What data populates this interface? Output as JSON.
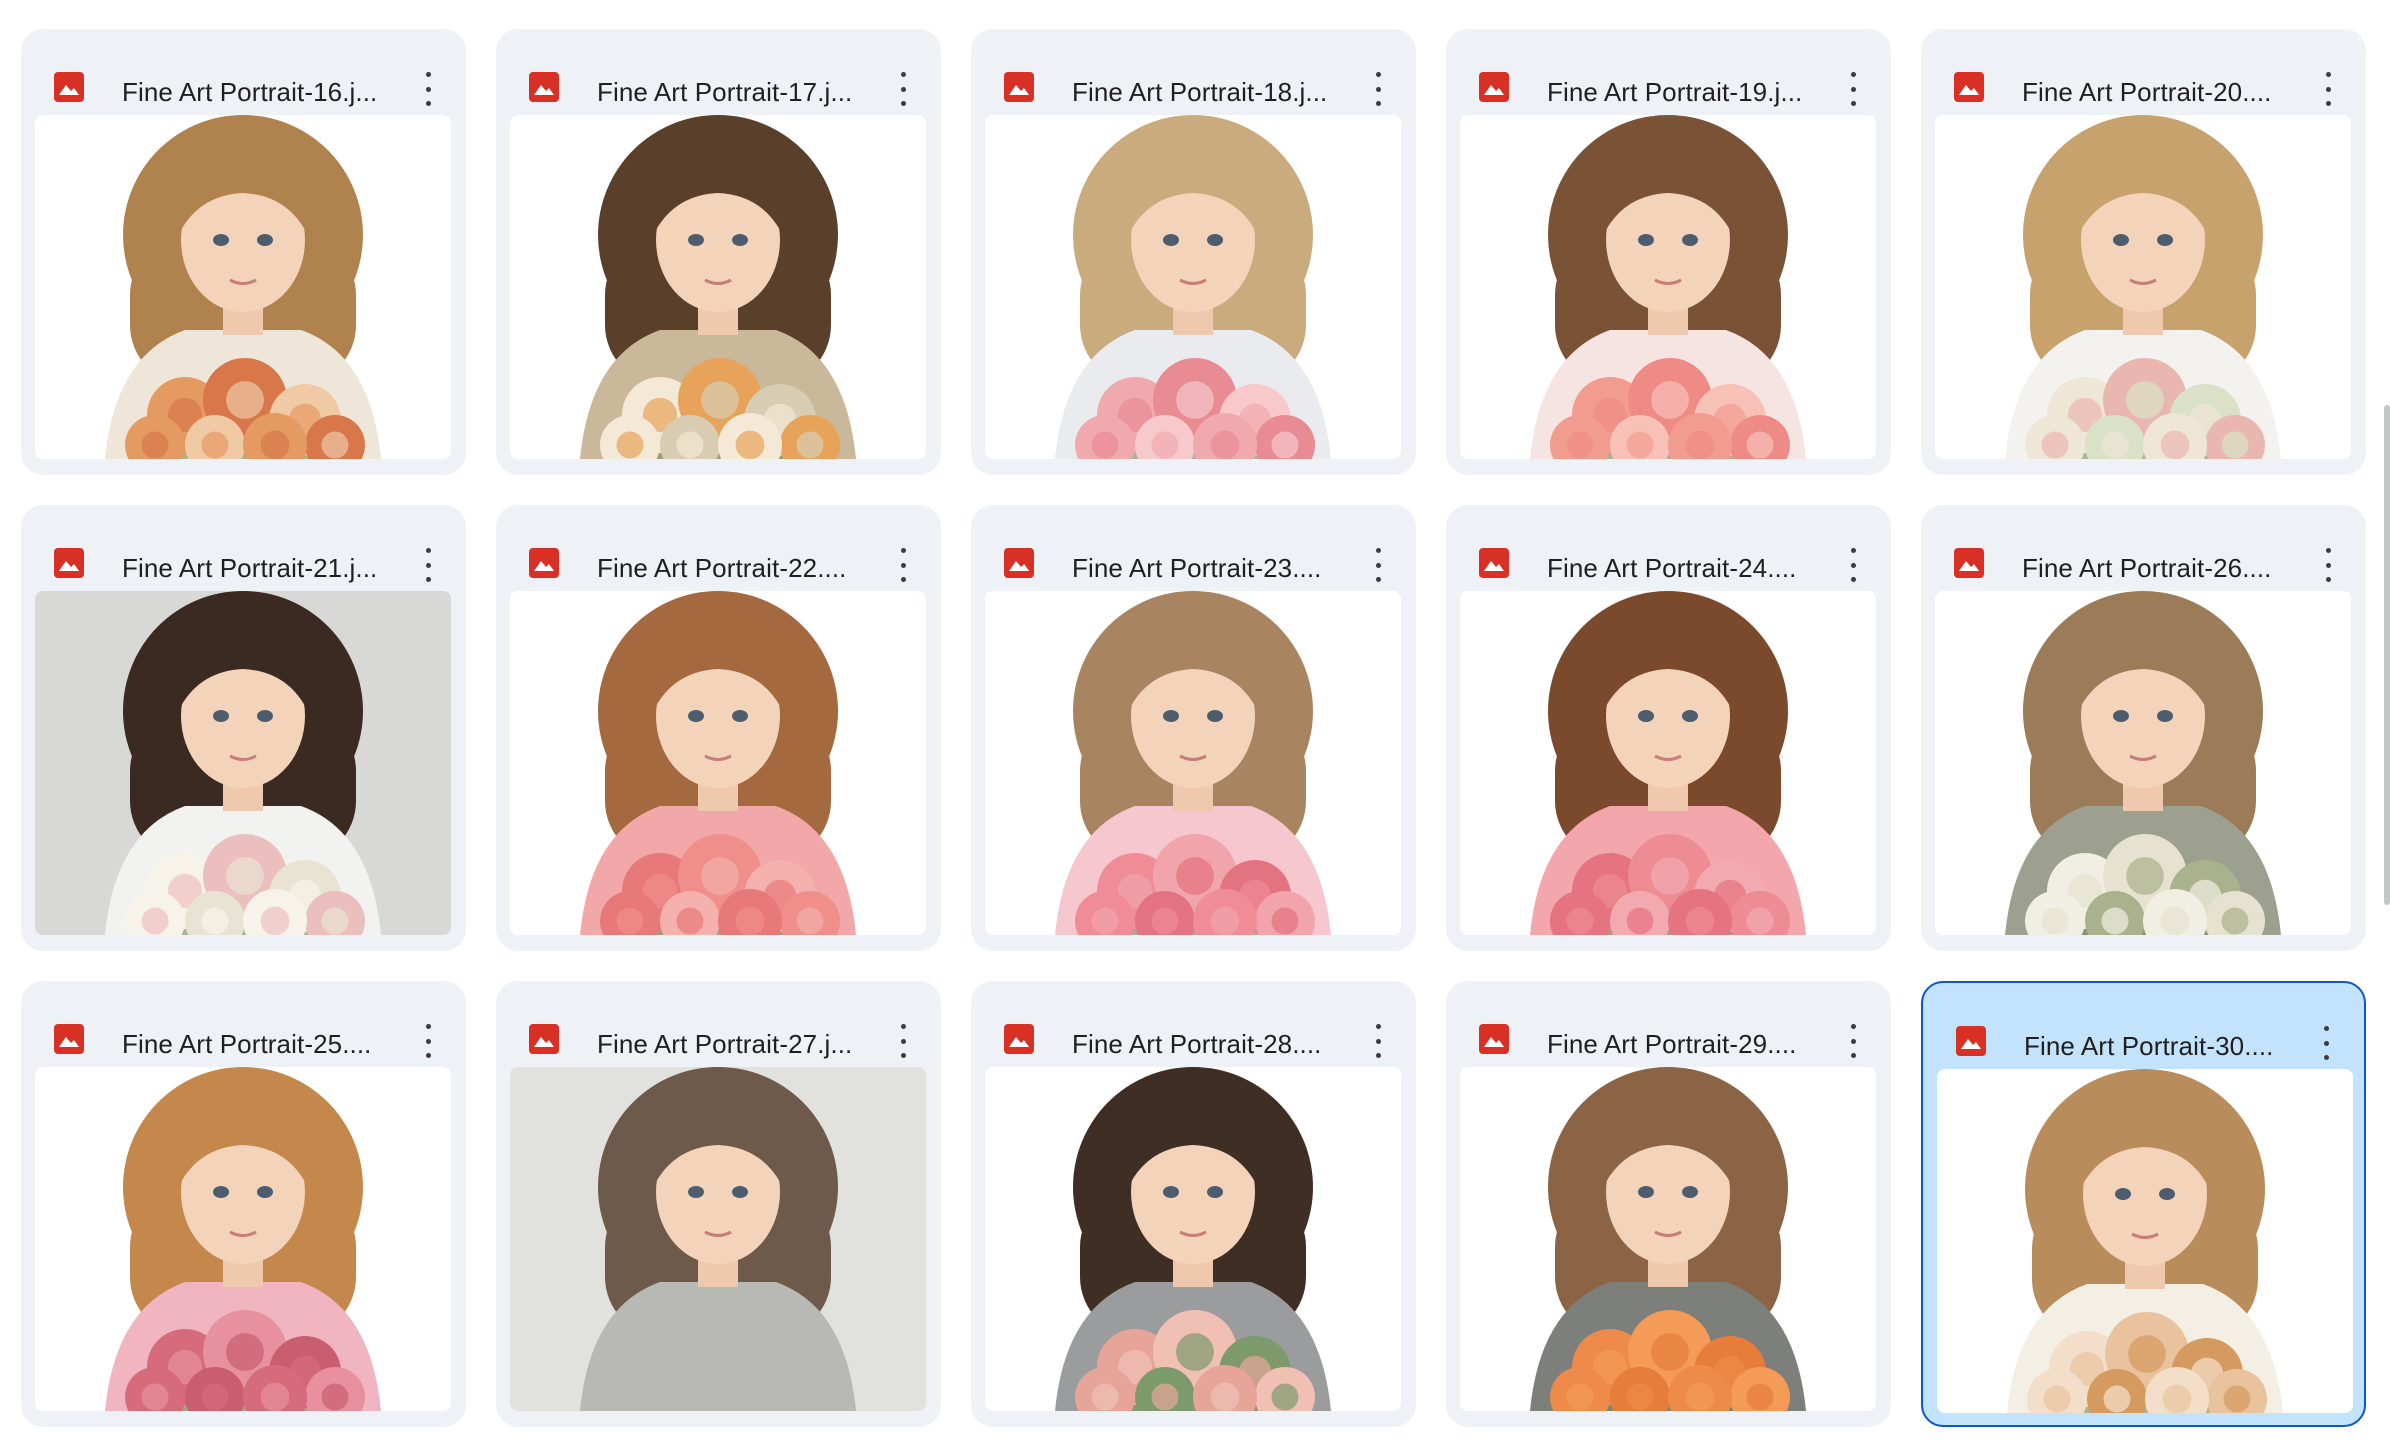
{
  "colors": {
    "card_bg": "#eef1f6",
    "card_selected_bg": "#c2e3fb",
    "card_selected_border": "#0b57d0",
    "file_icon": "#d93025"
  },
  "files": [
    {
      "name": "Fine Art Portrait-16.j...",
      "icon": "image-file-icon",
      "selected": false,
      "bg": "#ffffff",
      "hair": "#b0824e",
      "dress": "#efe6da",
      "flowers": [
        "#e59a62",
        "#d7774a",
        "#f0c9a5"
      ]
    },
    {
      "name": "Fine Art Portrait-17.j...",
      "icon": "image-file-icon",
      "selected": false,
      "bg": "#ffffff",
      "hair": "#5a3f2b",
      "dress": "#c9b89a",
      "flowers": [
        "#f3e9d6",
        "#e7a35a",
        "#d8cdb3"
      ]
    },
    {
      "name": "Fine Art Portrait-18.j...",
      "icon": "image-file-icon",
      "selected": false,
      "bg": "#ffffff",
      "hair": "#c9ab7d",
      "dress": "#e9ebee",
      "flowers": [
        "#f0a9ad",
        "#e88b93",
        "#f7c9cb"
      ]
    },
    {
      "name": "Fine Art Portrait-19.j...",
      "icon": "image-file-icon",
      "selected": false,
      "bg": "#ffffff",
      "hair": "#7a5236",
      "dress": "#f5e4e2",
      "flowers": [
        "#f29c8f",
        "#ee8b86",
        "#f7c1b8"
      ]
    },
    {
      "name": "Fine Art Portrait-20....",
      "icon": "image-file-icon",
      "selected": false,
      "bg": "#ffffff",
      "hair": "#c8a26c",
      "dress": "#f4f2ee",
      "flowers": [
        "#eee6d6",
        "#e9b7b0",
        "#d9e2c6"
      ]
    },
    {
      "name": "Fine Art Portrait-21.j...",
      "icon": "image-file-icon",
      "selected": false,
      "bg": "#d8d8d6",
      "hair": "#3b2a22",
      "dress": "#f2f2f0",
      "flowers": [
        "#f7f3ea",
        "#ecbfbf",
        "#e9e3d3"
      ]
    },
    {
      "name": "Fine Art Portrait-22....",
      "icon": "image-file-icon",
      "selected": false,
      "bg": "#ffffff",
      "hair": "#a4693f",
      "dress": "#f2a8a8",
      "flowers": [
        "#e8797b",
        "#ef8e8b",
        "#f4b1ad"
      ]
    },
    {
      "name": "Fine Art Portrait-23....",
      "icon": "image-file-icon",
      "selected": false,
      "bg": "#ffffff",
      "hair": "#a98461",
      "dress": "#f6c7cf",
      "flowers": [
        "#ef8c96",
        "#f1a4ac",
        "#e37380"
      ]
    },
    {
      "name": "Fine Art Portrait-24....",
      "icon": "image-file-icon",
      "selected": false,
      "bg": "#ffffff",
      "hair": "#7b4a2d",
      "dress": "#f3a7ad",
      "flowers": [
        "#e57480",
        "#ed8c93",
        "#f2aab0"
      ]
    },
    {
      "name": "Fine Art Portrait-26....",
      "icon": "image-file-icon",
      "selected": false,
      "bg": "#ffffff",
      "hair": "#9c7b58",
      "dress": "#9da08e",
      "flowers": [
        "#f1efe3",
        "#e6e2cf",
        "#a9b28c"
      ]
    },
    {
      "name": "Fine Art Portrait-25....",
      "icon": "image-file-icon",
      "selected": false,
      "bg": "#ffffff",
      "hair": "#c4884d",
      "dress": "#f0b5c0",
      "flowers": [
        "#d66b7b",
        "#e8919e",
        "#c85e6e"
      ]
    },
    {
      "name": "Fine Art Portrait-27.j...",
      "icon": "image-file-icon",
      "selected": false,
      "bg": "#e1e2dd",
      "hair": "#6e5a4a",
      "dress": "#b8b8b4",
      "flowers": []
    },
    {
      "name": "Fine Art Portrait-28....",
      "icon": "image-file-icon",
      "selected": false,
      "bg": "#ffffff",
      "hair": "#3f2e24",
      "dress": "#9b9c9d",
      "flowers": [
        "#e7a59a",
        "#f0c0b5",
        "#7c9a6c"
      ]
    },
    {
      "name": "Fine Art Portrait-29....",
      "icon": "image-file-icon",
      "selected": false,
      "bg": "#ffffff",
      "hair": "#8a6445",
      "dress": "#7d7f7b",
      "flowers": [
        "#ee8a4a",
        "#f39b57",
        "#e67d3b"
      ]
    },
    {
      "name": "Fine Art Portrait-30....",
      "icon": "image-file-icon",
      "selected": true,
      "bg": "#ffffff",
      "hair": "#b98c5c",
      "dress": "#f3efe5",
      "flowers": [
        "#f3dfc9",
        "#e9c39e",
        "#d59a5f"
      ]
    }
  ]
}
